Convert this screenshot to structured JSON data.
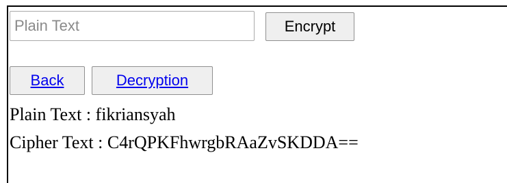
{
  "form": {
    "input_value": "",
    "input_placeholder": "Plain Text",
    "encrypt_label": "Encrypt"
  },
  "nav": {
    "back_label": "Back",
    "decryption_label": "Decryption"
  },
  "result": {
    "plain_label": "Plain Text",
    "plain_value": "fikriansyah",
    "cipher_label": "Cipher Text",
    "cipher_value": "C4rQPKFhwrgbRAaZvSKDDA=="
  }
}
